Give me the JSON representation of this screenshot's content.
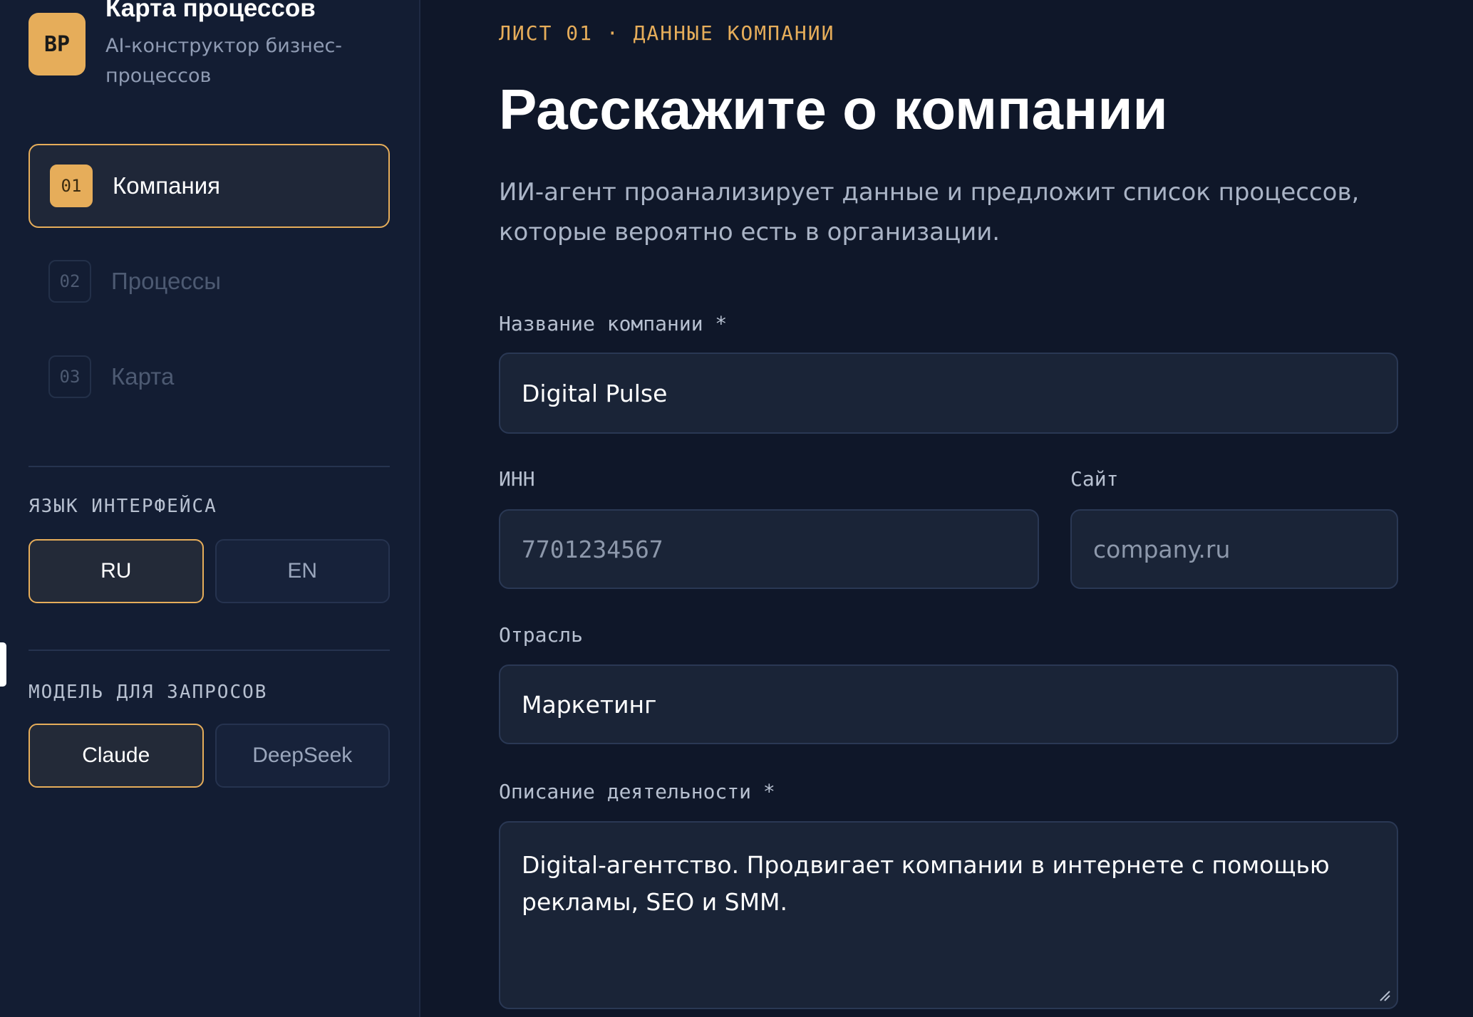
{
  "app": {
    "logo": "BP",
    "title": "Карта процессов",
    "subtitle": "AI-конструктор бизнес-процессов"
  },
  "steps": [
    {
      "num": "01",
      "label": "Компания",
      "active": true
    },
    {
      "num": "02",
      "label": "Процессы",
      "active": false
    },
    {
      "num": "03",
      "label": "Карта",
      "active": false
    }
  ],
  "language": {
    "title": "ЯЗЫК ИНТЕРФЕЙСА",
    "options": [
      "RU",
      "EN"
    ],
    "selected": "RU"
  },
  "model": {
    "title": "МОДЕЛЬ ДЛЯ ЗАПРОСОВ",
    "options": [
      "Claude",
      "DeepSeek"
    ],
    "selected": "Claude"
  },
  "main": {
    "eyebrow": "ЛИСТ 01 · ДАННЫЕ КОМПАНИИ",
    "title": "Расскажите о компании",
    "lead": "ИИ-агент проанализирует данные и предложит список процессов, которые вероятно есть в организации."
  },
  "form": {
    "company_name": {
      "label": "Название компании *",
      "value": "Digital Pulse"
    },
    "inn": {
      "label": "ИНН",
      "placeholder": "7701234567"
    },
    "site": {
      "label": "Сайт",
      "placeholder": "company.ru"
    },
    "industry": {
      "label": "Отрасль",
      "value": "Маркетинг"
    },
    "description": {
      "label": "Описание деятельности *",
      "value": "Digital-агентство. Продвигает компании в интернете с помощью рекламы, SEO и SMM."
    }
  },
  "colors": {
    "accent": "#e6ad5a",
    "background": "#0f1729",
    "sidebar": "#131d33"
  }
}
